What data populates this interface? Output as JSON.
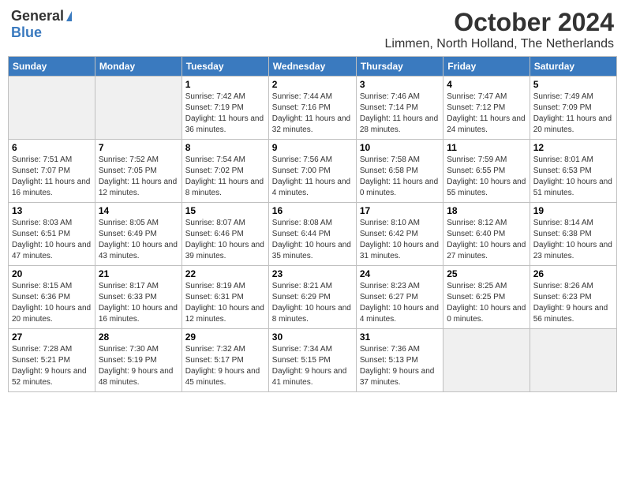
{
  "logo": {
    "general": "General",
    "blue": "Blue"
  },
  "title": "October 2024",
  "location": "Limmen, North Holland, The Netherlands",
  "weekdays": [
    "Sunday",
    "Monday",
    "Tuesday",
    "Wednesday",
    "Thursday",
    "Friday",
    "Saturday"
  ],
  "weeks": [
    [
      {
        "day": "",
        "empty": true
      },
      {
        "day": "",
        "empty": true
      },
      {
        "day": "1",
        "sunrise": "Sunrise: 7:42 AM",
        "sunset": "Sunset: 7:19 PM",
        "daylight": "Daylight: 11 hours and 36 minutes."
      },
      {
        "day": "2",
        "sunrise": "Sunrise: 7:44 AM",
        "sunset": "Sunset: 7:16 PM",
        "daylight": "Daylight: 11 hours and 32 minutes."
      },
      {
        "day": "3",
        "sunrise": "Sunrise: 7:46 AM",
        "sunset": "Sunset: 7:14 PM",
        "daylight": "Daylight: 11 hours and 28 minutes."
      },
      {
        "day": "4",
        "sunrise": "Sunrise: 7:47 AM",
        "sunset": "Sunset: 7:12 PM",
        "daylight": "Daylight: 11 hours and 24 minutes."
      },
      {
        "day": "5",
        "sunrise": "Sunrise: 7:49 AM",
        "sunset": "Sunset: 7:09 PM",
        "daylight": "Daylight: 11 hours and 20 minutes."
      }
    ],
    [
      {
        "day": "6",
        "sunrise": "Sunrise: 7:51 AM",
        "sunset": "Sunset: 7:07 PM",
        "daylight": "Daylight: 11 hours and 16 minutes."
      },
      {
        "day": "7",
        "sunrise": "Sunrise: 7:52 AM",
        "sunset": "Sunset: 7:05 PM",
        "daylight": "Daylight: 11 hours and 12 minutes."
      },
      {
        "day": "8",
        "sunrise": "Sunrise: 7:54 AM",
        "sunset": "Sunset: 7:02 PM",
        "daylight": "Daylight: 11 hours and 8 minutes."
      },
      {
        "day": "9",
        "sunrise": "Sunrise: 7:56 AM",
        "sunset": "Sunset: 7:00 PM",
        "daylight": "Daylight: 11 hours and 4 minutes."
      },
      {
        "day": "10",
        "sunrise": "Sunrise: 7:58 AM",
        "sunset": "Sunset: 6:58 PM",
        "daylight": "Daylight: 11 hours and 0 minutes."
      },
      {
        "day": "11",
        "sunrise": "Sunrise: 7:59 AM",
        "sunset": "Sunset: 6:55 PM",
        "daylight": "Daylight: 10 hours and 55 minutes."
      },
      {
        "day": "12",
        "sunrise": "Sunrise: 8:01 AM",
        "sunset": "Sunset: 6:53 PM",
        "daylight": "Daylight: 10 hours and 51 minutes."
      }
    ],
    [
      {
        "day": "13",
        "sunrise": "Sunrise: 8:03 AM",
        "sunset": "Sunset: 6:51 PM",
        "daylight": "Daylight: 10 hours and 47 minutes."
      },
      {
        "day": "14",
        "sunrise": "Sunrise: 8:05 AM",
        "sunset": "Sunset: 6:49 PM",
        "daylight": "Daylight: 10 hours and 43 minutes."
      },
      {
        "day": "15",
        "sunrise": "Sunrise: 8:07 AM",
        "sunset": "Sunset: 6:46 PM",
        "daylight": "Daylight: 10 hours and 39 minutes."
      },
      {
        "day": "16",
        "sunrise": "Sunrise: 8:08 AM",
        "sunset": "Sunset: 6:44 PM",
        "daylight": "Daylight: 10 hours and 35 minutes."
      },
      {
        "day": "17",
        "sunrise": "Sunrise: 8:10 AM",
        "sunset": "Sunset: 6:42 PM",
        "daylight": "Daylight: 10 hours and 31 minutes."
      },
      {
        "day": "18",
        "sunrise": "Sunrise: 8:12 AM",
        "sunset": "Sunset: 6:40 PM",
        "daylight": "Daylight: 10 hours and 27 minutes."
      },
      {
        "day": "19",
        "sunrise": "Sunrise: 8:14 AM",
        "sunset": "Sunset: 6:38 PM",
        "daylight": "Daylight: 10 hours and 23 minutes."
      }
    ],
    [
      {
        "day": "20",
        "sunrise": "Sunrise: 8:15 AM",
        "sunset": "Sunset: 6:36 PM",
        "daylight": "Daylight: 10 hours and 20 minutes."
      },
      {
        "day": "21",
        "sunrise": "Sunrise: 8:17 AM",
        "sunset": "Sunset: 6:33 PM",
        "daylight": "Daylight: 10 hours and 16 minutes."
      },
      {
        "day": "22",
        "sunrise": "Sunrise: 8:19 AM",
        "sunset": "Sunset: 6:31 PM",
        "daylight": "Daylight: 10 hours and 12 minutes."
      },
      {
        "day": "23",
        "sunrise": "Sunrise: 8:21 AM",
        "sunset": "Sunset: 6:29 PM",
        "daylight": "Daylight: 10 hours and 8 minutes."
      },
      {
        "day": "24",
        "sunrise": "Sunrise: 8:23 AM",
        "sunset": "Sunset: 6:27 PM",
        "daylight": "Daylight: 10 hours and 4 minutes."
      },
      {
        "day": "25",
        "sunrise": "Sunrise: 8:25 AM",
        "sunset": "Sunset: 6:25 PM",
        "daylight": "Daylight: 10 hours and 0 minutes."
      },
      {
        "day": "26",
        "sunrise": "Sunrise: 8:26 AM",
        "sunset": "Sunset: 6:23 PM",
        "daylight": "Daylight: 9 hours and 56 minutes."
      }
    ],
    [
      {
        "day": "27",
        "sunrise": "Sunrise: 7:28 AM",
        "sunset": "Sunset: 5:21 PM",
        "daylight": "Daylight: 9 hours and 52 minutes."
      },
      {
        "day": "28",
        "sunrise": "Sunrise: 7:30 AM",
        "sunset": "Sunset: 5:19 PM",
        "daylight": "Daylight: 9 hours and 48 minutes."
      },
      {
        "day": "29",
        "sunrise": "Sunrise: 7:32 AM",
        "sunset": "Sunset: 5:17 PM",
        "daylight": "Daylight: 9 hours and 45 minutes."
      },
      {
        "day": "30",
        "sunrise": "Sunrise: 7:34 AM",
        "sunset": "Sunset: 5:15 PM",
        "daylight": "Daylight: 9 hours and 41 minutes."
      },
      {
        "day": "31",
        "sunrise": "Sunrise: 7:36 AM",
        "sunset": "Sunset: 5:13 PM",
        "daylight": "Daylight: 9 hours and 37 minutes."
      },
      {
        "day": "",
        "empty": true
      },
      {
        "day": "",
        "empty": true
      }
    ]
  ]
}
